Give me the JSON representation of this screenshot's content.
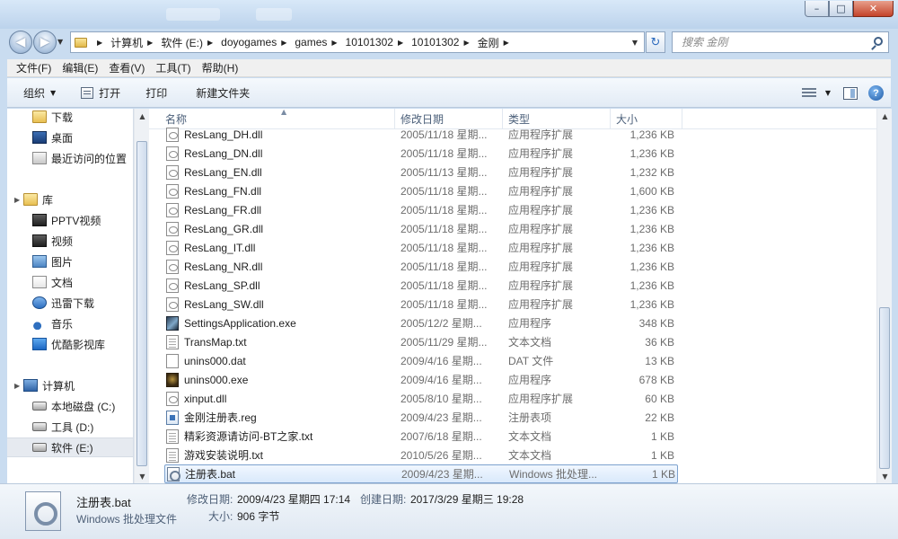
{
  "window": {
    "controls": {
      "minimize": "–",
      "maximize": "□",
      "close": "✕"
    }
  },
  "nav": {
    "back": "◀",
    "forward": "▶",
    "breadcrumbs": [
      "计算机",
      "软件 (E:)",
      "doyogames",
      "games",
      "10101302",
      "10101302",
      "金刚"
    ],
    "search_placeholder": "搜索 金刚"
  },
  "menu": [
    "文件(F)",
    "编辑(E)",
    "查看(V)",
    "工具(T)",
    "帮助(H)"
  ],
  "commands": {
    "organize": "组织",
    "open": "打开",
    "print": "打印",
    "new_folder": "新建文件夹"
  },
  "sidebar": {
    "favorites": [
      {
        "label": "下载",
        "icon": "folder-icon"
      },
      {
        "label": "桌面",
        "icon": "desktop-icon"
      },
      {
        "label": "最近访问的位置",
        "icon": "recent-places-icon"
      }
    ],
    "libraries_title": "库",
    "libraries": [
      {
        "label": "PPTV视频",
        "icon": "video-library-icon"
      },
      {
        "label": "视频",
        "icon": "video-library-icon"
      },
      {
        "label": "图片",
        "icon": "pictures-library-icon"
      },
      {
        "label": "文档",
        "icon": "documents-library-icon"
      },
      {
        "label": "迅雷下载",
        "icon": "download-library-icon"
      },
      {
        "label": "音乐",
        "icon": "music-library-icon"
      },
      {
        "label": "优酷影视库",
        "icon": "youku-library-icon"
      }
    ],
    "computer_title": "计算机",
    "drives": [
      {
        "label": "本地磁盘 (C:)",
        "icon": "drive-icon"
      },
      {
        "label": "工具 (D:)",
        "icon": "drive-icon"
      },
      {
        "label": "软件 (E:)",
        "icon": "drive-icon",
        "selected": true
      }
    ]
  },
  "columns": {
    "name": "名称",
    "date": "修改日期",
    "type": "类型",
    "size": "大小"
  },
  "files": [
    {
      "name": "ResLang_DH.dll",
      "date": "2005/11/18 星期...",
      "type": "应用程序扩展",
      "size": "1,236 KB",
      "icon": "dll"
    },
    {
      "name": "ResLang_DN.dll",
      "date": "2005/11/18 星期...",
      "type": "应用程序扩展",
      "size": "1,236 KB",
      "icon": "dll"
    },
    {
      "name": "ResLang_EN.dll",
      "date": "2005/11/13 星期...",
      "type": "应用程序扩展",
      "size": "1,232 KB",
      "icon": "dll"
    },
    {
      "name": "ResLang_FN.dll",
      "date": "2005/11/18 星期...",
      "type": "应用程序扩展",
      "size": "1,600 KB",
      "icon": "dll"
    },
    {
      "name": "ResLang_FR.dll",
      "date": "2005/11/18 星期...",
      "type": "应用程序扩展",
      "size": "1,236 KB",
      "icon": "dll"
    },
    {
      "name": "ResLang_GR.dll",
      "date": "2005/11/18 星期...",
      "type": "应用程序扩展",
      "size": "1,236 KB",
      "icon": "dll"
    },
    {
      "name": "ResLang_IT.dll",
      "date": "2005/11/18 星期...",
      "type": "应用程序扩展",
      "size": "1,236 KB",
      "icon": "dll"
    },
    {
      "name": "ResLang_NR.dll",
      "date": "2005/11/18 星期...",
      "type": "应用程序扩展",
      "size": "1,236 KB",
      "icon": "dll"
    },
    {
      "name": "ResLang_SP.dll",
      "date": "2005/11/18 星期...",
      "type": "应用程序扩展",
      "size": "1,236 KB",
      "icon": "dll"
    },
    {
      "name": "ResLang_SW.dll",
      "date": "2005/11/18 星期...",
      "type": "应用程序扩展",
      "size": "1,236 KB",
      "icon": "dll"
    },
    {
      "name": "SettingsApplication.exe",
      "date": "2005/12/2 星期...",
      "type": "应用程序",
      "size": "348 KB",
      "icon": "app"
    },
    {
      "name": "TransMap.txt",
      "date": "2005/11/29 星期...",
      "type": "文本文档",
      "size": "36 KB",
      "icon": "txt"
    },
    {
      "name": "unins000.dat",
      "date": "2009/4/16 星期...",
      "type": "DAT 文件",
      "size": "13 KB",
      "icon": "dat"
    },
    {
      "name": "unins000.exe",
      "date": "2009/4/16 星期...",
      "type": "应用程序",
      "size": "678 KB",
      "icon": "exe"
    },
    {
      "name": "xinput.dll",
      "date": "2005/8/10 星期...",
      "type": "应用程序扩展",
      "size": "60 KB",
      "icon": "dll"
    },
    {
      "name": "金刚注册表.reg",
      "date": "2009/4/23 星期...",
      "type": "注册表项",
      "size": "22 KB",
      "icon": "reg"
    },
    {
      "name": "精彩资源请访问-BT之家.txt",
      "date": "2007/6/18 星期...",
      "type": "文本文档",
      "size": "1 KB",
      "icon": "txt"
    },
    {
      "name": "游戏安装说明.txt",
      "date": "2010/5/26 星期...",
      "type": "文本文档",
      "size": "1 KB",
      "icon": "txt"
    },
    {
      "name": "注册表.bat",
      "date": "2009/4/23 星期...",
      "type": "Windows 批处理...",
      "size": "1 KB",
      "icon": "bat",
      "selected": true
    }
  ],
  "details": {
    "name": "注册表.bat",
    "type": "Windows 批处理文件",
    "modified_label": "修改日期:",
    "modified_value": "2009/4/23 星期四 17:14",
    "created_label": "创建日期:",
    "created_value": "2017/3/29 星期三 19:28",
    "size_label": "大小:",
    "size_value": "906 字节"
  },
  "colors": {
    "accent": "#3a72b8",
    "selection_bg": "#d9e9fb",
    "selection_border": "#7da2ce",
    "window_frame": "#c9dcf0"
  }
}
